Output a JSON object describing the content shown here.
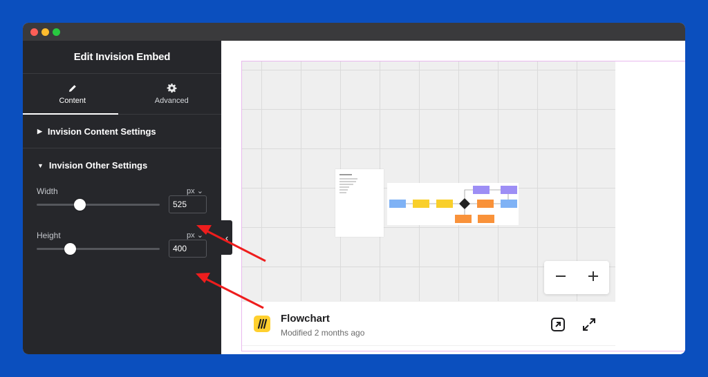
{
  "colors": {
    "background": "#0b4fbe",
    "panel": "#26272b",
    "arrow": "#ee1d1d",
    "outline": "#e9b8ee",
    "miro_yellow": "#ffd02f"
  },
  "window": {
    "buttons": [
      "close",
      "minimize",
      "maximize"
    ]
  },
  "panel": {
    "title": "Edit Invision Embed",
    "tabs": [
      {
        "label": "Content",
        "icon": "pencil-icon",
        "active": true
      },
      {
        "label": "Advanced",
        "icon": "gear-icon",
        "active": false
      }
    ],
    "sections": {
      "content_settings": {
        "label": "Invision Content Settings",
        "expanded": false
      },
      "other_settings": {
        "label": "Invision Other Settings",
        "expanded": true
      }
    },
    "width": {
      "label": "Width",
      "unit": "px",
      "value": "525",
      "slider_fraction": 0.35
    },
    "height": {
      "label": "Height",
      "unit": "px",
      "value": "400",
      "slider_fraction": 0.27
    }
  },
  "embed": {
    "board_name": "Flowchart",
    "modified": "Modified 2 months ago",
    "zoom_out_icon": "minus-icon",
    "zoom_in_icon": "plus-icon",
    "open_icon": "open-external-icon",
    "fullscreen_icon": "expand-icon"
  }
}
